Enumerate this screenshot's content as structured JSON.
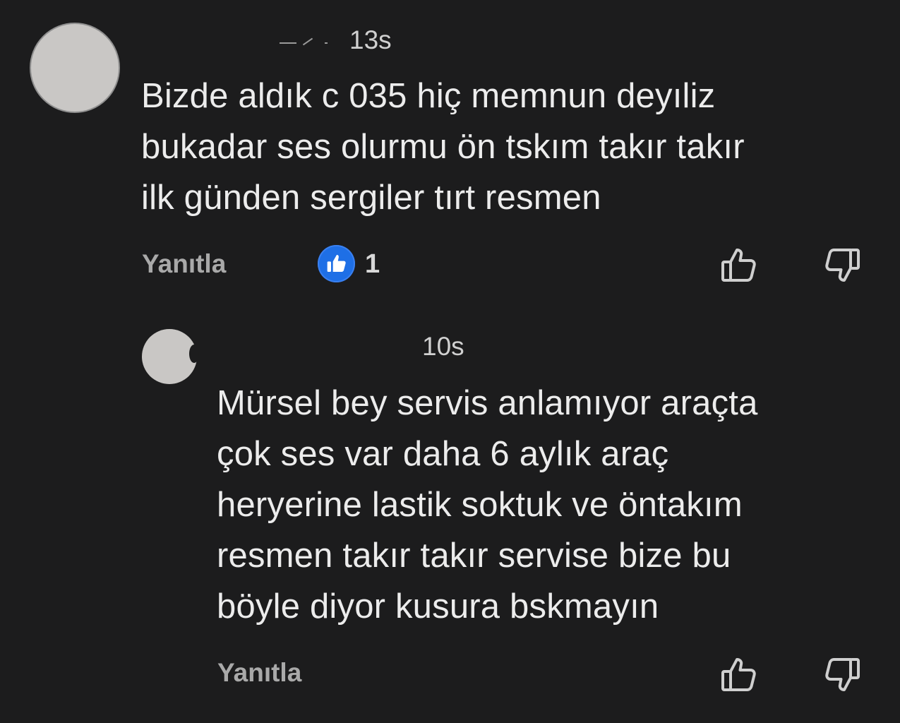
{
  "comments": [
    {
      "time_fragment": "13s",
      "lines": [
        "Bizde aldık c 035 hiç memnun deyıliz",
        "bukadar ses olurmu ön tskım takır takır",
        "ilk günden sergiler tırt resmen"
      ],
      "reply_label": "Yanıtla",
      "like_count": "1",
      "icons": {
        "creator_heart": "thumbs-up-badge-icon",
        "like": "thumbs-up-icon",
        "dislike": "thumbs-down-icon"
      }
    },
    {
      "time_fragment": "10s",
      "lines": [
        "Mürsel bey servis anlamıyor araçta",
        "çok ses var daha 6 aylık araç",
        "heryerine lastik soktuk ve öntakım",
        "resmen takır takır servise bize bu",
        "böyle diyor kusura bskmayın"
      ],
      "reply_label": "Yanıtla",
      "icons": {
        "like": "thumbs-up-icon",
        "dislike": "thumbs-down-icon"
      }
    }
  ],
  "colors": {
    "background": "#1c1c1d",
    "text": "#ececec",
    "muted": "#a9a9a9",
    "accent": "#1e6fe6"
  }
}
